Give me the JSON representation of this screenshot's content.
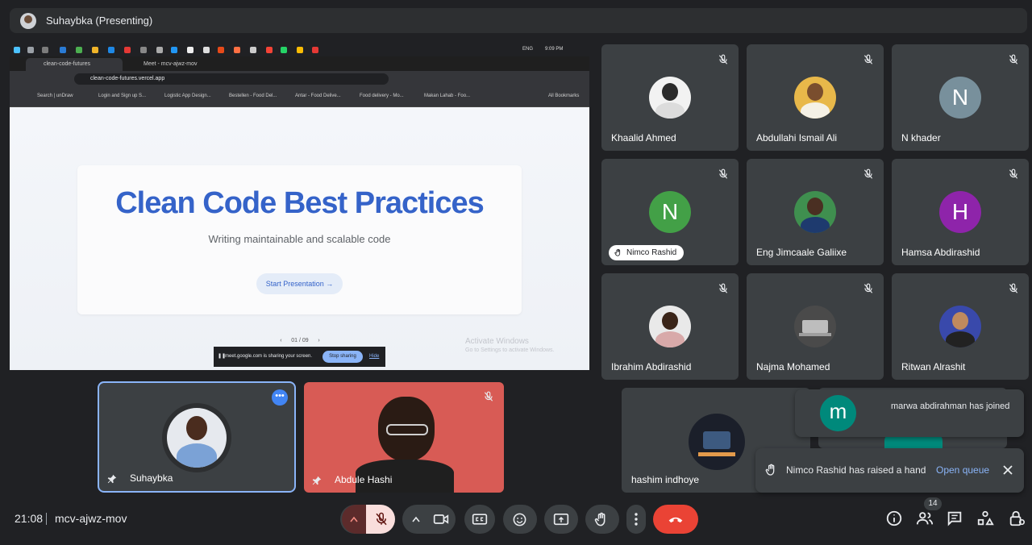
{
  "header": {
    "presenter_title": "Suhaybka (Presenting)"
  },
  "shared_screen": {
    "tabs": [
      "clean-code-futures",
      "Meet - mcv-ajwz-mov"
    ],
    "url": "clean-code-futures.vercel.app",
    "taskbar_lang": "ENG",
    "taskbar_time": "9:09 PM",
    "bookmarks": [
      "Search | unDraw",
      "Login and Sign up S...",
      "Logistic App Design...",
      "Bestellen - Food Del...",
      "Antar - Food Delive...",
      "Food delivery - Mo...",
      "Makan Lahab - Foo..."
    ],
    "bookmarks_folder": "All Bookmarks",
    "hero_title": "Clean Code Best Practices",
    "hero_subtitle": "Writing maintainable and scalable code",
    "start_button": "Start Presentation",
    "pager_text": "01 / 09",
    "activate_title": "Activate Windows",
    "activate_sub": "Go to Settings to activate Windows.",
    "sharing_text": "meet.google.com is sharing your screen.",
    "stop_sharing": "Stop sharing",
    "hide": "Hide"
  },
  "participants": [
    {
      "name": "Khaalid Ahmed"
    },
    {
      "name": "Abdullahi Ismail Ali"
    },
    {
      "name": "N khader",
      "letter": "N"
    },
    {
      "name": "Nimco Rashid",
      "letter": "N"
    },
    {
      "name": "Eng Jimcaale Galiixe"
    },
    {
      "name": "Hamsa Abdirashid",
      "letter": "H"
    },
    {
      "name": "Ibrahim Abdirashid"
    },
    {
      "name": "Najma Mohamed"
    },
    {
      "name": "Ritwan Alrashit"
    },
    {
      "name": "hashim indhoye"
    }
  ],
  "bottom_tiles": [
    {
      "name": "Suhaybka"
    },
    {
      "name": "Abdule Hashi"
    }
  ],
  "notifications": {
    "joined_avatar_letter": "m",
    "joined_text": "marwa abdirahman has joined",
    "hand_text": "Nimco Rashid has raised a hand",
    "open_queue": "Open queue"
  },
  "footer": {
    "time": "21:08",
    "meeting_code": "mcv-ajwz-mov",
    "people_count": "14"
  },
  "colors": {
    "accent": "#8ab4f8",
    "leave_red": "#ea4335",
    "mic_off_pink": "#f9dedc",
    "hero_blue": "#3563c9"
  }
}
